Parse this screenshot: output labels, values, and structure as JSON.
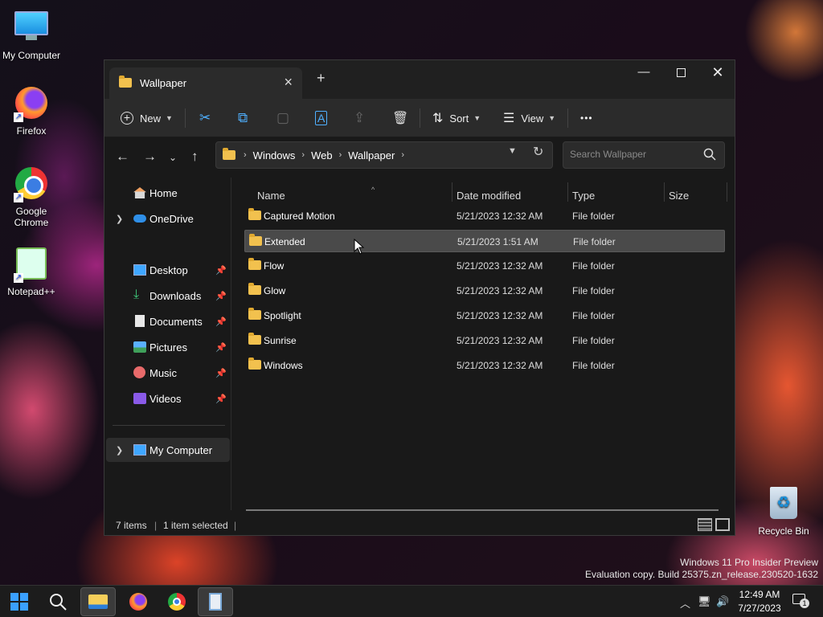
{
  "desktop": {
    "icons": [
      {
        "label": "My Computer"
      },
      {
        "label": "Firefox"
      },
      {
        "label": "Google Chrome"
      },
      {
        "label": "Notepad++"
      },
      {
        "label": "Recycle Bin"
      }
    ],
    "watermark_line1": "Windows 11 Pro Insider Preview",
    "watermark_line2": "Evaluation copy. Build 25375.zn_release.230520-1632"
  },
  "window": {
    "tab_title": "Wallpaper",
    "toolbar": {
      "new_label": "New",
      "sort_label": "Sort",
      "view_label": "View",
      "more_label": "•••"
    },
    "address": {
      "crumbs": [
        "Windows",
        "Web",
        "Wallpaper"
      ]
    },
    "search_placeholder": "Search Wallpaper",
    "sidebar": {
      "items": [
        {
          "label": "Home",
          "icon": "home-icon"
        },
        {
          "label": "OneDrive",
          "icon": "cloud-icon"
        },
        {
          "label": "Desktop",
          "icon": "desktop-icon",
          "pinned": true
        },
        {
          "label": "Downloads",
          "icon": "download-icon",
          "pinned": true
        },
        {
          "label": "Documents",
          "icon": "document-icon",
          "pinned": true
        },
        {
          "label": "Pictures",
          "icon": "pictures-icon",
          "pinned": true
        },
        {
          "label": "Music",
          "icon": "music-icon",
          "pinned": true
        },
        {
          "label": "Videos",
          "icon": "video-icon",
          "pinned": true
        },
        {
          "label": "My Computer",
          "icon": "computer-icon"
        }
      ]
    },
    "columns": {
      "name": "Name",
      "date": "Date modified",
      "type": "Type",
      "size": "Size"
    },
    "files": [
      {
        "name": "Captured Motion",
        "date": "5/21/2023 12:32 AM",
        "type": "File folder"
      },
      {
        "name": "Extended",
        "date": "5/21/2023 1:51 AM",
        "type": "File folder",
        "selected": true
      },
      {
        "name": "Flow",
        "date": "5/21/2023 12:32 AM",
        "type": "File folder"
      },
      {
        "name": "Glow",
        "date": "5/21/2023 12:32 AM",
        "type": "File folder"
      },
      {
        "name": "Spotlight",
        "date": "5/21/2023 12:32 AM",
        "type": "File folder"
      },
      {
        "name": "Sunrise",
        "date": "5/21/2023 12:32 AM",
        "type": "File folder"
      },
      {
        "name": "Windows",
        "date": "5/21/2023 12:32 AM",
        "type": "File folder"
      }
    ],
    "status": {
      "items_count": "7 items",
      "selected_count": "1 item selected"
    }
  },
  "taskbar": {
    "time": "12:49 AM",
    "date": "7/27/2023",
    "notification_count": "1"
  },
  "colors": {
    "accent": "#4fb0ff",
    "folder": "#f2c14e",
    "window_bg": "#191919",
    "selected_row": "#4a4a4a"
  }
}
